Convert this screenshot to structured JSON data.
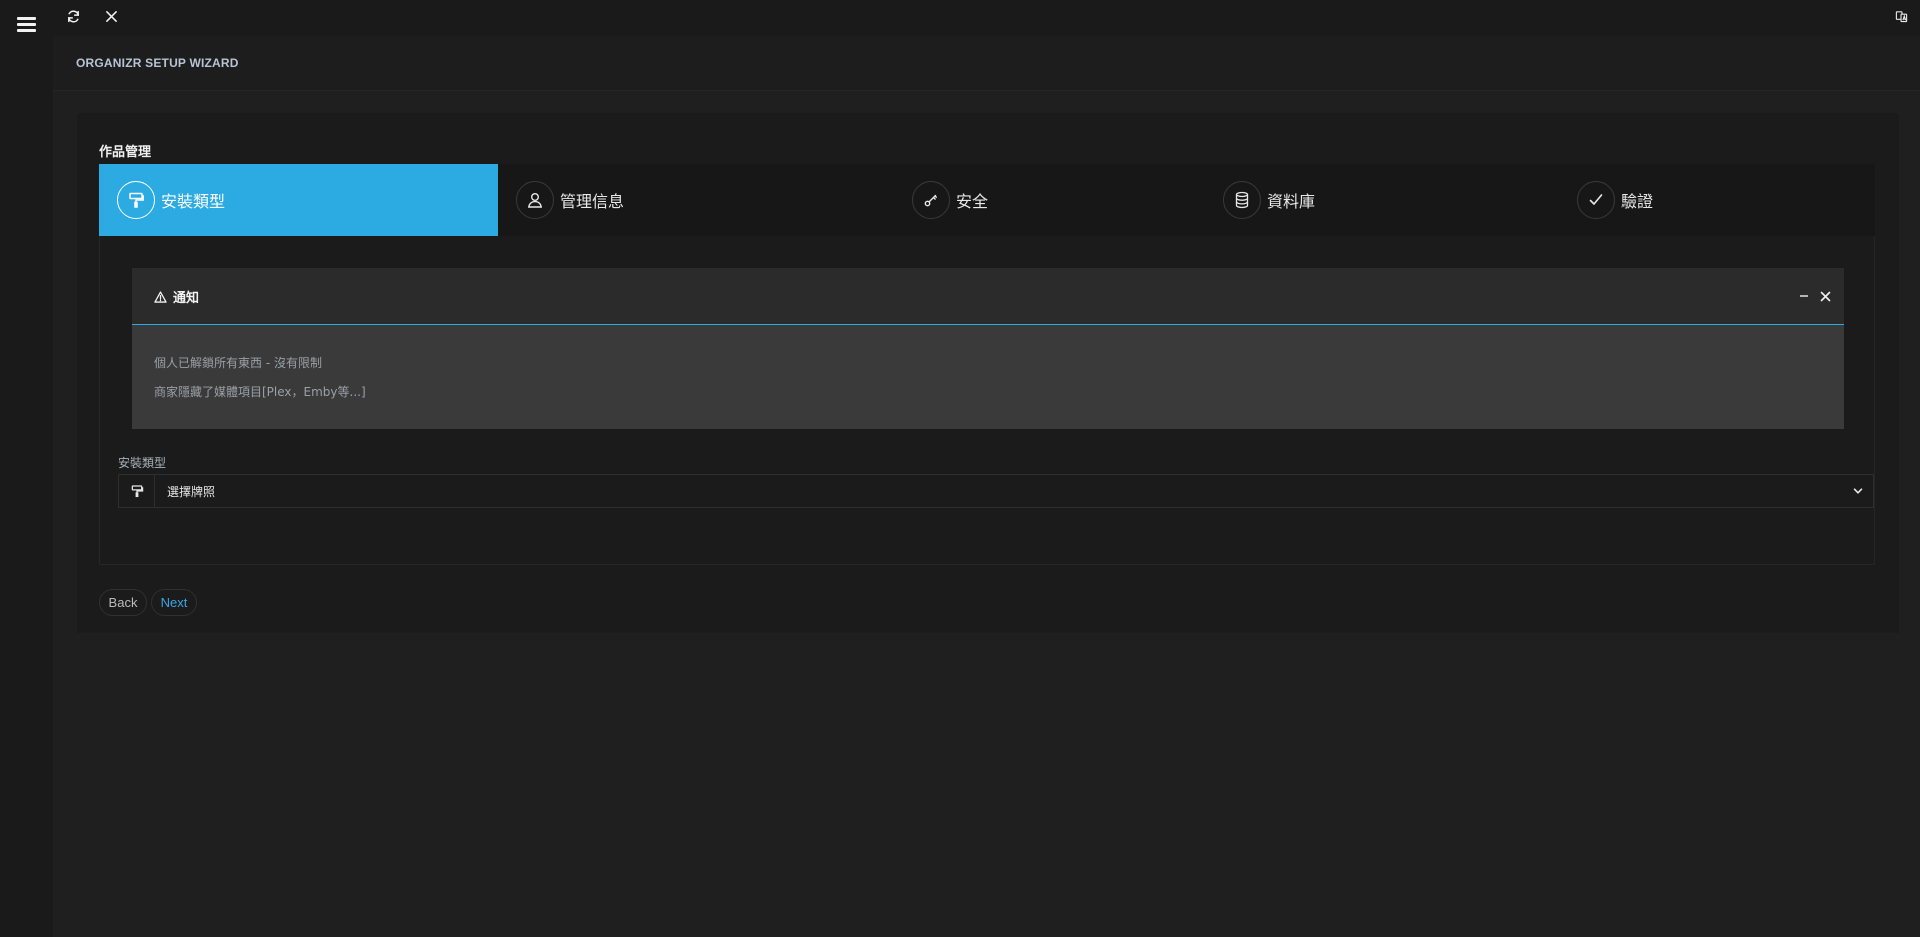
{
  "header": {
    "title": "ORGANIZR SETUP WIZARD"
  },
  "panel": {
    "title": "作品管理"
  },
  "steps": [
    {
      "label": "安裝類型",
      "icon": "paint-roller-icon",
      "active": true
    },
    {
      "label": "管理信息",
      "icon": "user-icon",
      "active": false
    },
    {
      "label": "安全",
      "icon": "key-icon",
      "active": false
    },
    {
      "label": "資料庫",
      "icon": "database-icon",
      "active": false
    },
    {
      "label": "驗證",
      "icon": "check-icon",
      "active": false
    }
  ],
  "notice": {
    "title": "通知",
    "lines": [
      "個人已解鎖所有東西 - 沒有限制",
      "商家隱藏了媒體項目[Plex，Emby等...]"
    ]
  },
  "install_type": {
    "label": "安裝類型",
    "selected": "選擇牌照"
  },
  "buttons": {
    "back": "Back",
    "next": "Next"
  },
  "colors": {
    "accent": "#2caae2",
    "background": "#1f1f1f",
    "panel": "#1b1b1b",
    "notice_body": "#3a3a3a",
    "next_text": "#3ba5e6"
  }
}
